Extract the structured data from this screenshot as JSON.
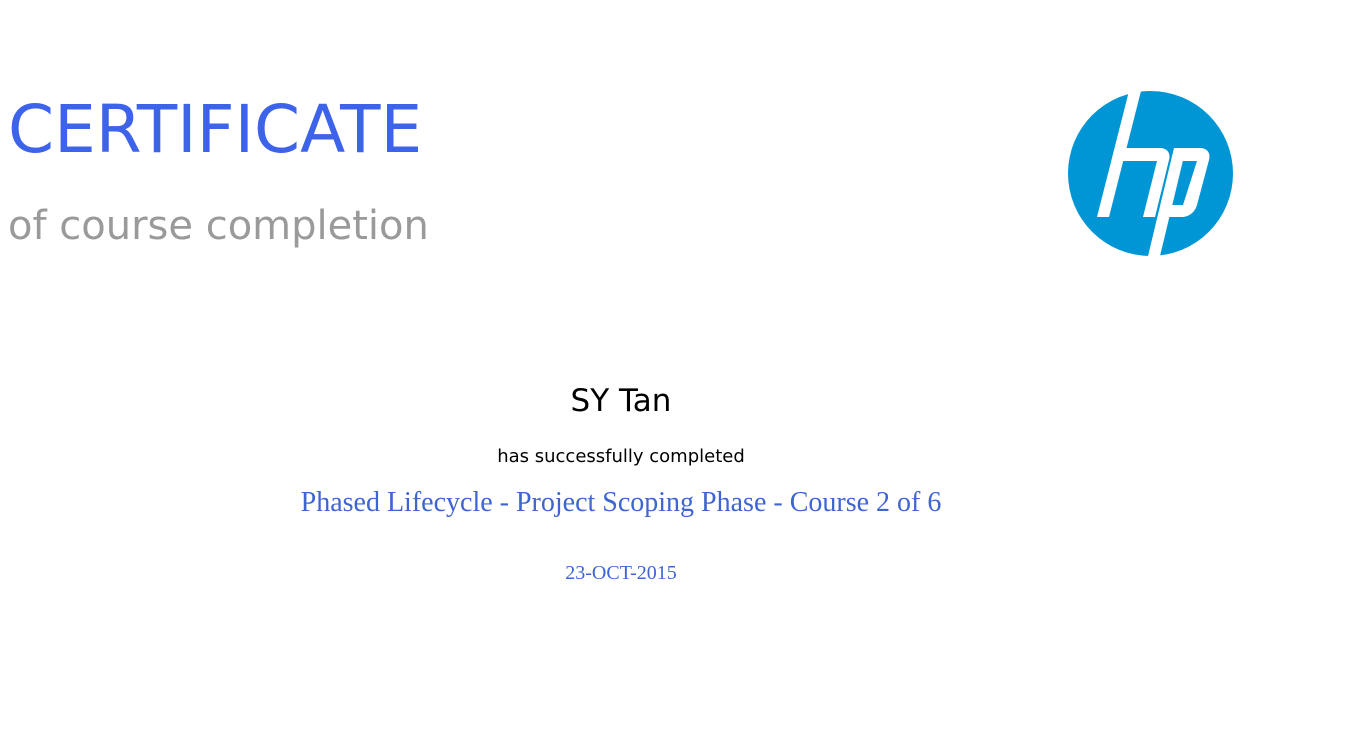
{
  "certificate": {
    "title": "CERTIFICATE",
    "subtitle": "of course completion",
    "recipient_name": "SY Tan",
    "completed_text": "has successfully completed",
    "course_name": "Phased Lifecycle - Project Scoping Phase - Course 2 of 6",
    "completion_date": "23-OCT-2015"
  },
  "logo": {
    "icon": "hp-logo-icon",
    "text": "hp"
  },
  "colors": {
    "title": "#3d63ea",
    "subtitle": "#9a9a9a",
    "body_text": "#000000",
    "course_text": "#3f64d4",
    "logo_blue": "#0096d6",
    "background": "#ffffff"
  }
}
